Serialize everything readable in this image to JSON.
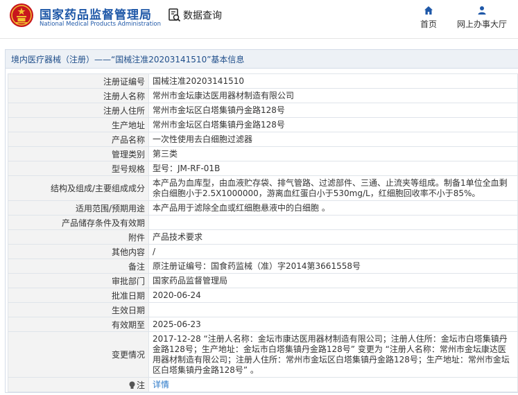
{
  "header": {
    "logo_cn": "国家药品监督管理局",
    "logo_en": "National Medical Products Administration",
    "data_query_label": "数据查询",
    "nav": [
      {
        "label": "首页",
        "icon": "home-icon"
      },
      {
        "label": "网上办事大厅",
        "icon": "user-icon"
      }
    ],
    "brand_color": "#1f58a8"
  },
  "panel": {
    "title": "境内医疗器械（注册）——“国械注准20203141510”基本信息"
  },
  "rows": [
    {
      "key": "注册证编号",
      "value": "国械注准20203141510"
    },
    {
      "key": "注册人名称",
      "value": "常州市金坛康达医用器材制造有限公司"
    },
    {
      "key": "注册人住所",
      "value": "常州市金坛区白塔集镇丹金路128号"
    },
    {
      "key": "生产地址",
      "value": "常州市金坛区白塔集镇丹金路128号"
    },
    {
      "key": "产品名称",
      "value": "一次性使用去白细胞过滤器"
    },
    {
      "key": "管理类别",
      "value": "第三类"
    },
    {
      "key": "型号规格",
      "value": "型号：JM-RF-01B"
    },
    {
      "key": "结构及组成/主要组成成分",
      "value": "本产品为血库型，由血液贮存袋、排气管路、过滤部件、三通、止流夹等组成。制备1单位全血剩余白细胞小于2.5X1000000，游离血红蛋白小于530mg/L，红细胞回收率不小于85%。"
    },
    {
      "key": "适用范围/预期用途",
      "value": "本产品用于滤除全血或红细胞悬液中的白细胞 。"
    },
    {
      "key": "产品储存条件及有效期",
      "value": ""
    },
    {
      "key": "附件",
      "value": "产品技术要求"
    },
    {
      "key": "其他内容",
      "value": "/"
    },
    {
      "key": "备注",
      "value": "原注册证编号：国食药监械（准）字2014第3661558号"
    },
    {
      "key": "审批部门",
      "value": "国家药品监督管理局"
    },
    {
      "key": "批准日期",
      "value": "2020-06-24"
    },
    {
      "key": "生效日期",
      "value": ""
    },
    {
      "key": "有效期至",
      "value": "2025-06-23"
    },
    {
      "key": "变更情况",
      "value": "2017-12-28 “注册人名称：金坛市康达医用器材制造有限公司；注册人住所：金坛市白塔集镇丹金路128号；生产地址：金坛市白塔集镇丹金路128号” 变更为 “注册人名称：常州市金坛康达医用器材制造有限公司；注册人住所：常州市金坛区白塔集镇丹金路128号；生产地址：常州市金坛区白塔集镇丹金路128号” 。"
    }
  ],
  "note": {
    "key": "注",
    "icon": "lightbulb-icon",
    "link_text": "详情"
  }
}
